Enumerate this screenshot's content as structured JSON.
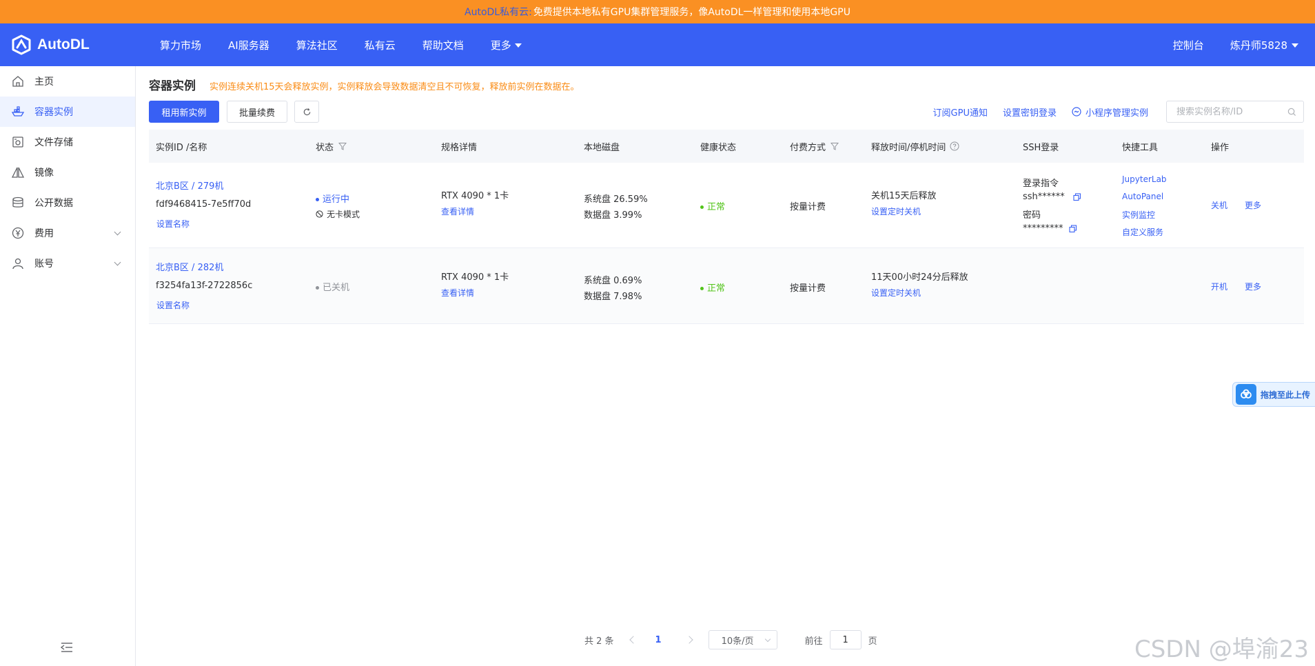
{
  "banner": {
    "brand": "AutoDL私有云:",
    "text": "免费提供本地私有GPU集群管理服务，像AutoDL一样管理和使用本地GPU"
  },
  "topnav": {
    "logo_text": "AutoDL",
    "links": [
      "算力市场",
      "AI服务器",
      "算法社区",
      "私有云",
      "帮助文档",
      "更多"
    ],
    "console": "控制台",
    "user": "炼丹师5828"
  },
  "sidebar": {
    "items": [
      {
        "label": "主页",
        "icon": "home-icon"
      },
      {
        "label": "容器实例",
        "icon": "container-icon"
      },
      {
        "label": "文件存储",
        "icon": "storage-icon"
      },
      {
        "label": "镜像",
        "icon": "image-icon"
      },
      {
        "label": "公开数据",
        "icon": "database-icon"
      },
      {
        "label": "费用",
        "icon": "yen-icon"
      },
      {
        "label": "账号",
        "icon": "user-icon"
      }
    ],
    "active_index": 1
  },
  "main": {
    "title": "容器实例",
    "warning": "实例连续关机15天会释放实例，实例释放会导致数据清空且不可恢复，释放前实例在数据在。",
    "buttons": {
      "rent": "租用新实例",
      "renew": "批量续费"
    },
    "tool_links": [
      "订阅GPU通知",
      "设置密钥登录",
      "小程序管理实例"
    ],
    "search_placeholder": "搜索实例名称/ID"
  },
  "table": {
    "headers": [
      "实例ID /名称",
      "状态",
      "规格详情",
      "本地磁盘",
      "健康状态",
      "付费方式",
      "释放时间/停机时间",
      "SSH登录",
      "快捷工具",
      "操作"
    ],
    "rows": [
      {
        "name": "北京B区 / 279机",
        "id": "fdf9468415-7e5ff70d",
        "set_name": "设置名称",
        "status": "运行中",
        "mode": "无卡模式",
        "spec": "RTX 4090 * 1卡",
        "spec_detail": "查看详情",
        "disk_sys": "系统盘 26.59%",
        "disk_data": "数据盘 3.99%",
        "health": "正常",
        "billing": "按量计费",
        "release": "关机15天后释放",
        "timer": "设置定时关机",
        "ssh_cmd_label": "登录指令",
        "ssh_cmd": "ssh******",
        "pwd_label": "密码",
        "pwd": "*********",
        "tools": [
          "JupyterLab",
          "AutoPanel",
          "实例监控",
          "自定义服务"
        ],
        "op1": "关机",
        "op2": "更多"
      },
      {
        "name": "北京B区 / 282机",
        "id": "f3254fa13f-2722856c",
        "set_name": "设置名称",
        "status": "已关机",
        "spec": "RTX 4090 * 1卡",
        "spec_detail": "查看详情",
        "disk_sys": "系统盘 0.69%",
        "disk_data": "数据盘 7.98%",
        "health": "正常",
        "billing": "按量计费",
        "release": "11天00小时24分后释放",
        "timer": "设置定时关机",
        "op1": "开机",
        "op2": "更多"
      }
    ]
  },
  "pager": {
    "total": "共 2 条",
    "current": "1",
    "page_size": "10条/页",
    "goto_label": "前往",
    "goto_value": "1",
    "page_word": "页"
  },
  "upload": {
    "label": "拖拽至此上传"
  },
  "watermark": "CSDN @埠渝23",
  "colors": {
    "primary": "#3860f4",
    "banner": "#fa9023",
    "warning": "#fa8c16",
    "success": "#52c41a"
  }
}
